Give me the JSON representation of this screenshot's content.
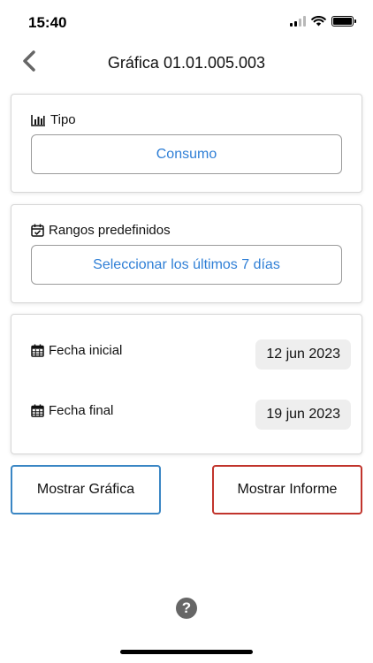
{
  "status_bar": {
    "time": "15:40",
    "icons": [
      "signal-icon",
      "wifi-icon",
      "battery-icon"
    ]
  },
  "nav": {
    "title": "Gráfica 01.01.005.003",
    "back_icon": "chevron-left-icon"
  },
  "tipo": {
    "label": "Tipo",
    "icon": "bar-chart-icon",
    "value": "Consumo"
  },
  "rangos": {
    "label": "Rangos predefinidos",
    "icon": "calendar-check-icon",
    "value": "Seleccionar los últimos 7 días"
  },
  "fechas": {
    "inicial_label": "Fecha inicial",
    "inicial_value": "12 jun 2023",
    "final_label": "Fecha final",
    "final_value": "19 jun 2023",
    "icon": "calendar-icon"
  },
  "actions": {
    "grafica_label": "Mostrar Gráfica",
    "informe_label": "Mostrar Informe"
  },
  "help": {
    "icon": "question-circle-icon",
    "glyph": "?"
  },
  "colors": {
    "accent_blue": "#2f7fd6",
    "grafica_border": "#3a86c4",
    "informe_border": "#c1342c"
  }
}
